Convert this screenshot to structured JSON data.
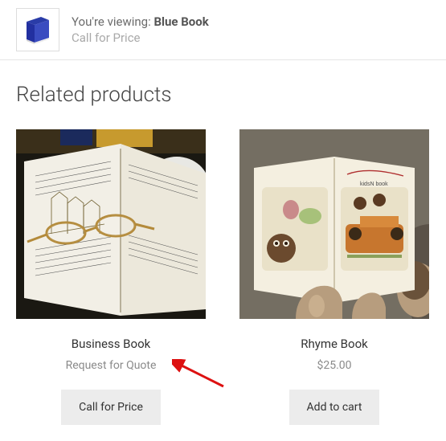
{
  "viewing": {
    "prefix": "You're viewing: ",
    "product_name": "Blue Book",
    "price_text": "Call for Price"
  },
  "related": {
    "heading": "Related products",
    "products": [
      {
        "title": "Business Book",
        "subtitle": "Request for Quote",
        "button_label": "Call for Price"
      },
      {
        "title": "Rhyme Book",
        "subtitle": "$25.00",
        "button_label": "Add to cart"
      }
    ]
  }
}
